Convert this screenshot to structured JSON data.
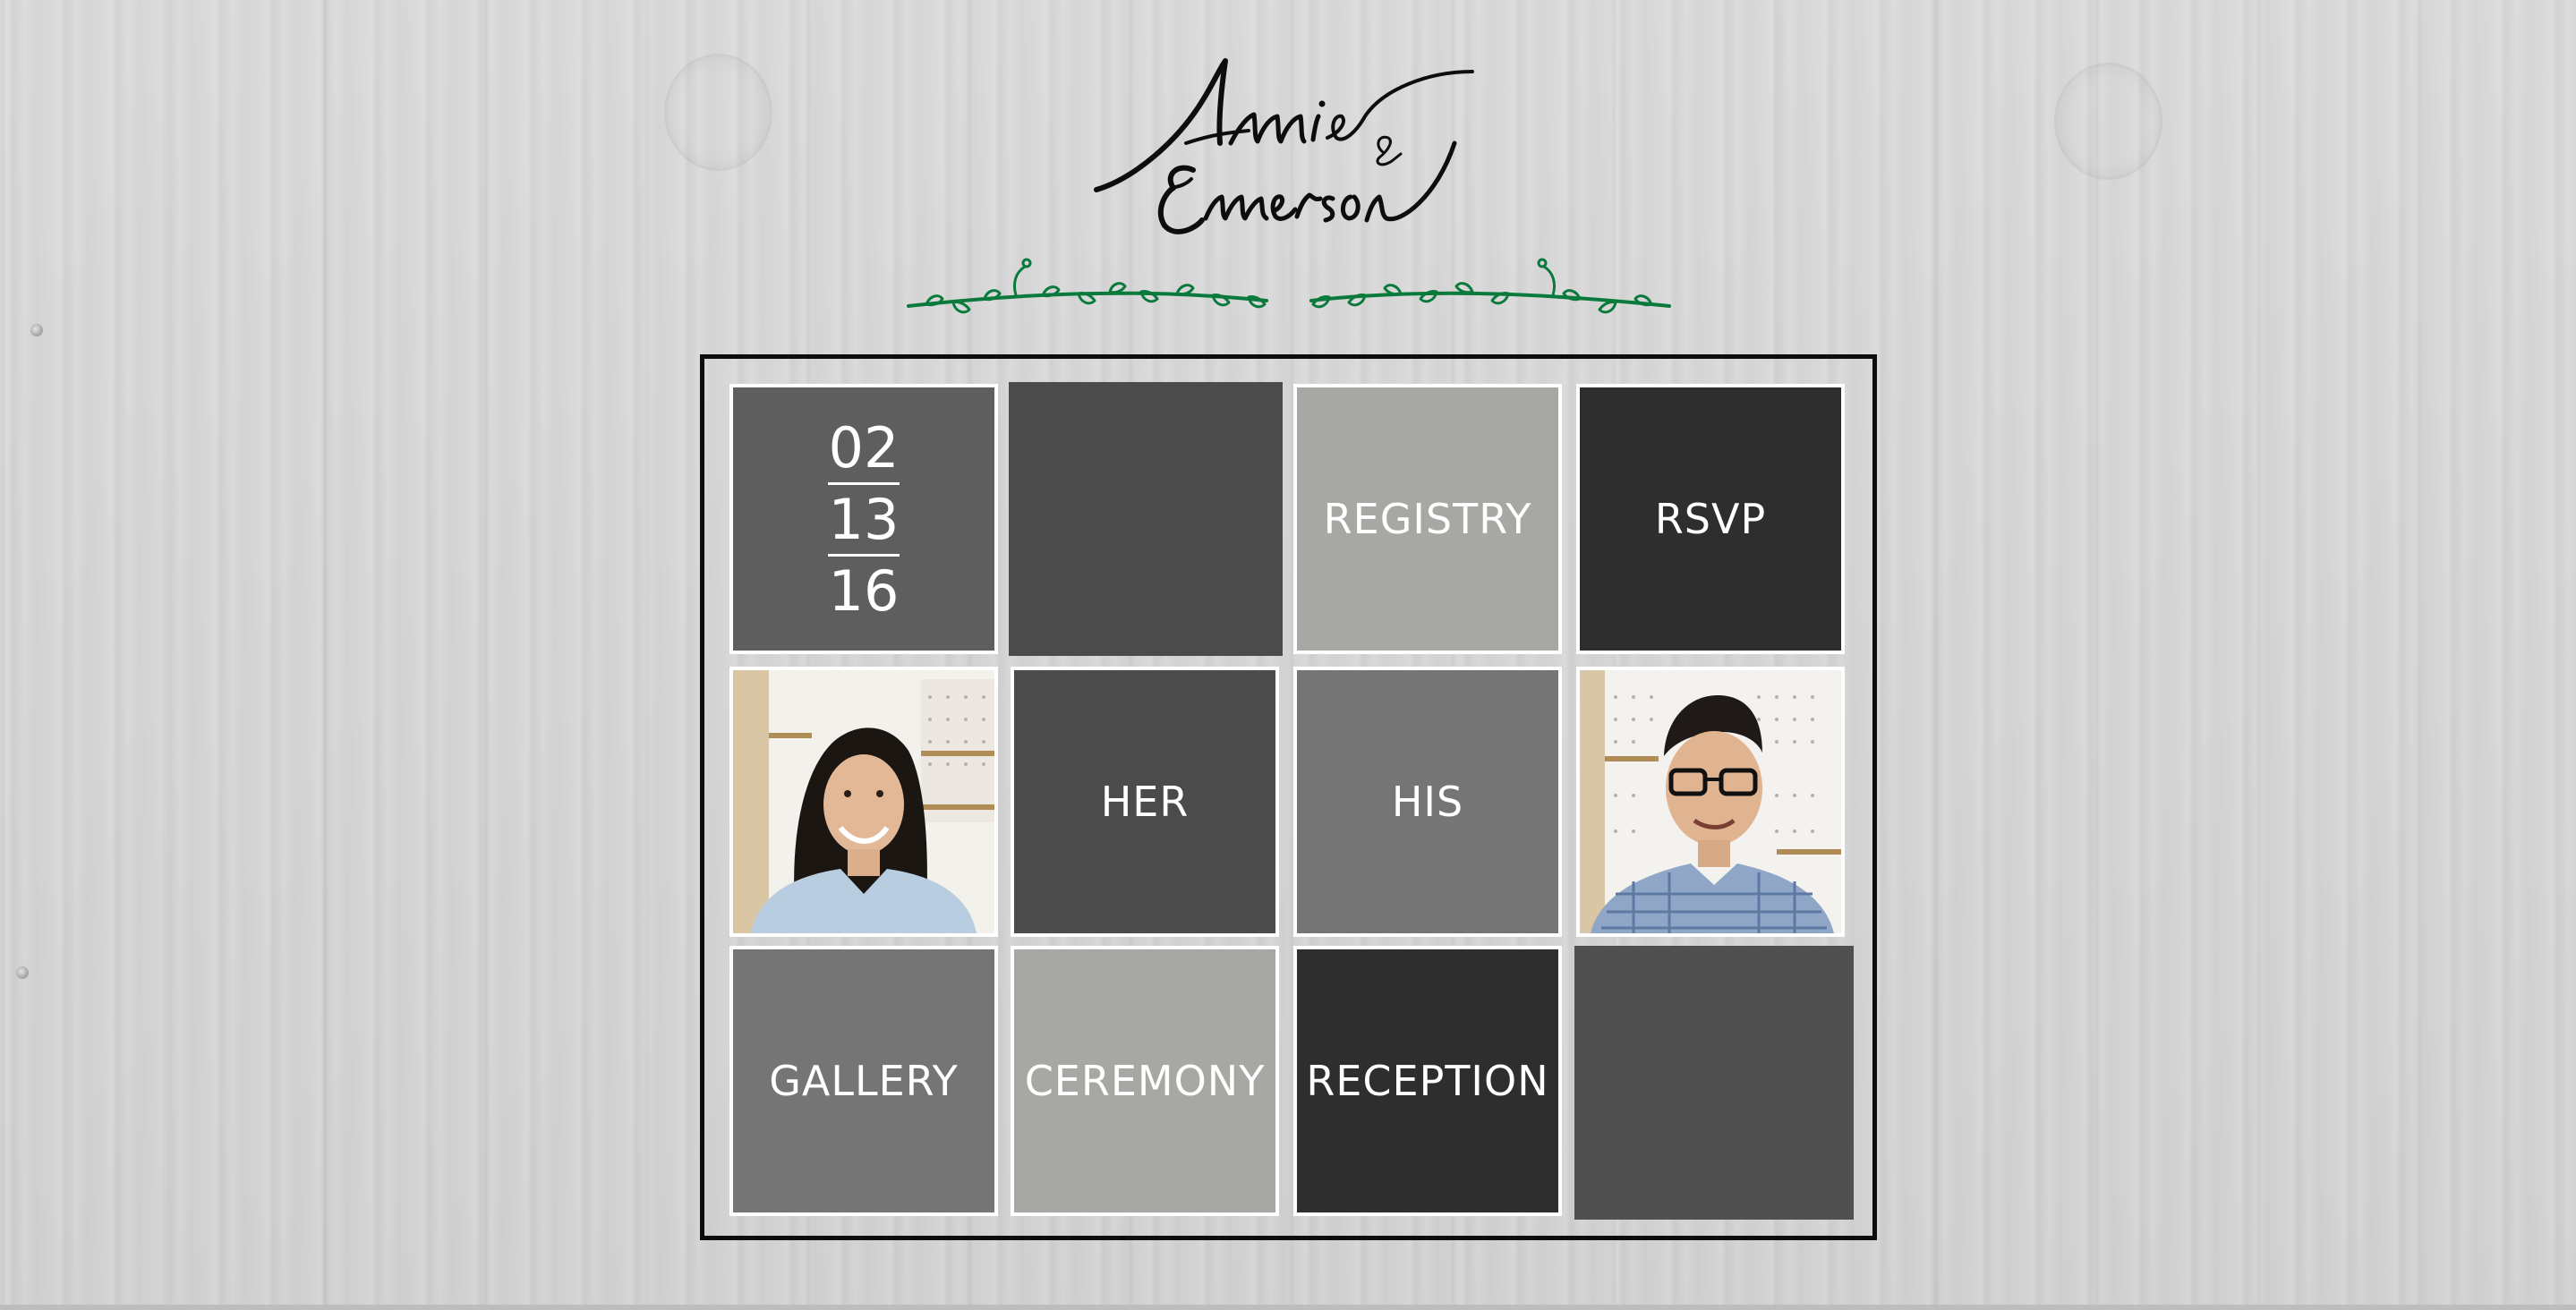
{
  "header": {
    "logo_name_1": "Annie",
    "logo_amp": "&",
    "logo_name_2": "Emerson"
  },
  "date": {
    "month": "02",
    "day": "13",
    "year": "16"
  },
  "tiles": {
    "registry": "REGISTRY",
    "rsvp": "RSVP",
    "her": "HER",
    "his": "HIS",
    "gallery": "GALLERY",
    "ceremony": "CEREMONY",
    "reception": "RECEPTION"
  },
  "colors": {
    "tile_dark": "#2e2e2e",
    "tile_charcoal": "#4b4b4b",
    "tile_charcoal_2": "#505050",
    "tile_mid": "#5e5e5e",
    "tile_gray": "#757575",
    "tile_light": "#a7a7a3",
    "vine_green": "#0a7a3c",
    "frame": "#0d0d0d"
  }
}
